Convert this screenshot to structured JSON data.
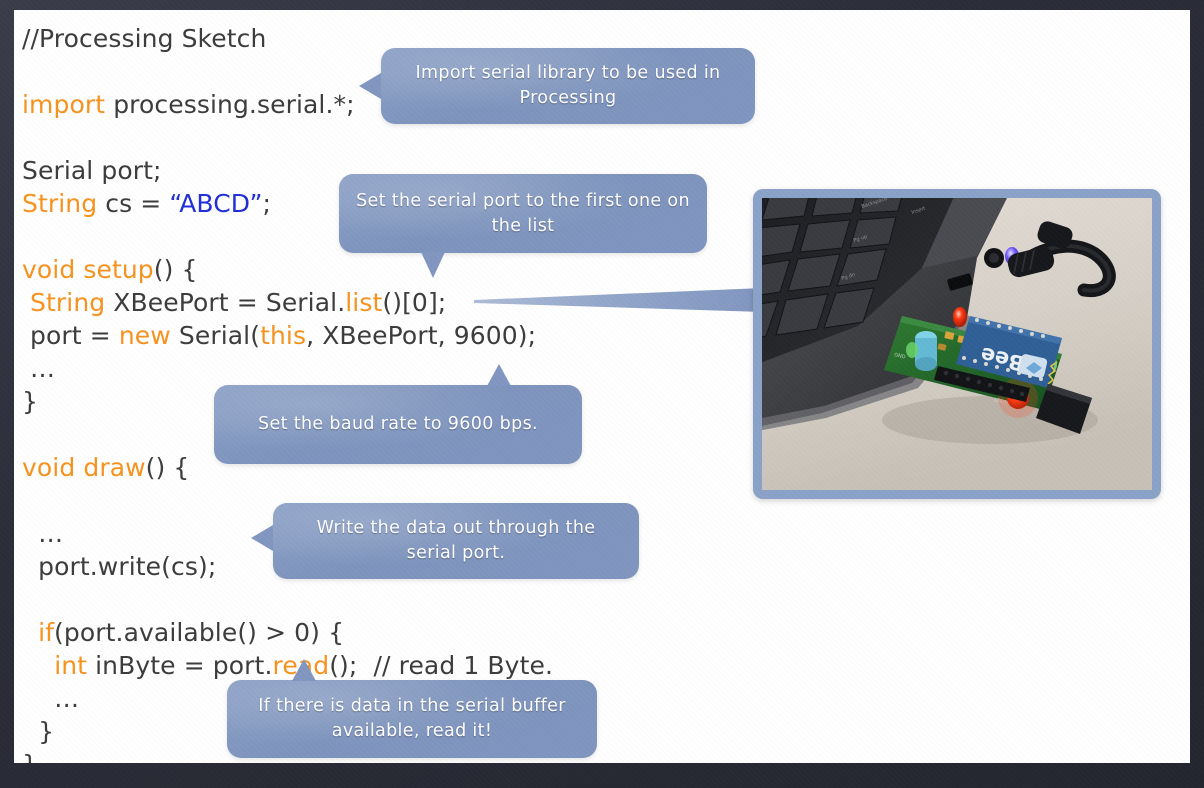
{
  "slide": {
    "background_color": "#2b2d3a",
    "canvas_color": "#ffffff"
  },
  "code": {
    "language": "Processing (Java)",
    "keyword_color": "#f7931e",
    "string_color": "#1f2fd8",
    "text_color": "#3c3c3c",
    "lines": [
      {
        "tokens": [
          {
            "t": "//Processing Sketch",
            "c": "plain"
          }
        ]
      },
      {
        "tokens": []
      },
      {
        "tokens": [
          {
            "t": "import",
            "c": "kw"
          },
          {
            "t": " processing.serial.*;",
            "c": "plain"
          }
        ]
      },
      {
        "tokens": []
      },
      {
        "tokens": [
          {
            "t": "Serial port;",
            "c": "plain"
          }
        ]
      },
      {
        "tokens": [
          {
            "t": "String",
            "c": "kw"
          },
          {
            "t": " cs = ",
            "c": "plain"
          },
          {
            "t": "“ABCD”",
            "c": "str"
          },
          {
            "t": ";",
            "c": "plain"
          }
        ]
      },
      {
        "tokens": []
      },
      {
        "tokens": [
          {
            "t": "void setup",
            "c": "kw"
          },
          {
            "t": "() {",
            "c": "plain"
          }
        ]
      },
      {
        "tokens": [
          {
            "t": " ",
            "c": "plain"
          },
          {
            "t": "String",
            "c": "kw"
          },
          {
            "t": " XBeePort = Serial.",
            "c": "plain"
          },
          {
            "t": "list",
            "c": "kw"
          },
          {
            "t": "()[0];",
            "c": "plain"
          }
        ]
      },
      {
        "tokens": [
          {
            "t": " port = ",
            "c": "plain"
          },
          {
            "t": "new",
            "c": "kw"
          },
          {
            "t": " Serial(",
            "c": "plain"
          },
          {
            "t": "this",
            "c": "kw"
          },
          {
            "t": ", XBeePort, 9600);",
            "c": "plain"
          }
        ]
      },
      {
        "tokens": [
          {
            "t": " …",
            "c": "plain"
          }
        ]
      },
      {
        "tokens": [
          {
            "t": "}",
            "c": "plain"
          }
        ]
      },
      {
        "tokens": []
      },
      {
        "tokens": [
          {
            "t": "void draw",
            "c": "kw"
          },
          {
            "t": "() {",
            "c": "plain"
          }
        ]
      },
      {
        "tokens": []
      },
      {
        "tokens": [
          {
            "t": "  …",
            "c": "plain"
          }
        ]
      },
      {
        "tokens": [
          {
            "t": "  port.write(cs);",
            "c": "plain"
          }
        ]
      },
      {
        "tokens": []
      },
      {
        "tokens": [
          {
            "t": "  ",
            "c": "plain"
          },
          {
            "t": "if",
            "c": "kw"
          },
          {
            "t": "(port.available() > 0) {",
            "c": "plain"
          }
        ]
      },
      {
        "tokens": [
          {
            "t": "    ",
            "c": "plain"
          },
          {
            "t": "int",
            "c": "kw"
          },
          {
            "t": " inByte = port.",
            "c": "plain"
          },
          {
            "t": "read",
            "c": "kw"
          },
          {
            "t": "();  // read 1 Byte.",
            "c": "plain"
          }
        ]
      },
      {
        "tokens": [
          {
            "t": "    …",
            "c": "plain"
          }
        ]
      },
      {
        "tokens": [
          {
            "t": "  }",
            "c": "plain"
          }
        ]
      },
      {
        "tokens": [
          {
            "t": "}",
            "c": "plain"
          }
        ]
      }
    ]
  },
  "callouts": [
    {
      "id": "import-callout",
      "text": "Import serial library to be used in Processing",
      "color": "#8196c0",
      "tail": "left"
    },
    {
      "id": "serial-port-callout",
      "text": "Set the serial port to the first one on the list",
      "color": "#8196c0",
      "tail": "down"
    },
    {
      "id": "baud-rate-callout",
      "text": "Set the baud rate to 9600 bps.",
      "color": "#8196c0",
      "tail": "up"
    },
    {
      "id": "write-data-callout",
      "text": "Write the data out through the serial port.",
      "color": "#8196c0",
      "tail": "left"
    },
    {
      "id": "read-buffer-callout",
      "text": "If there is data in the serial buffer available, read it!",
      "color": "#8196c0",
      "tail": "up"
    }
  ],
  "photo": {
    "caption": "XBee USB adapter board plugged into a laptop USB port",
    "frame_color": "#8ba2c8",
    "board_label": "XBee"
  },
  "pointer": {
    "name": "wedge-pointer",
    "color": "#8196c0",
    "points_from": "photo",
    "points_to": "Serial.list()[0] line"
  }
}
